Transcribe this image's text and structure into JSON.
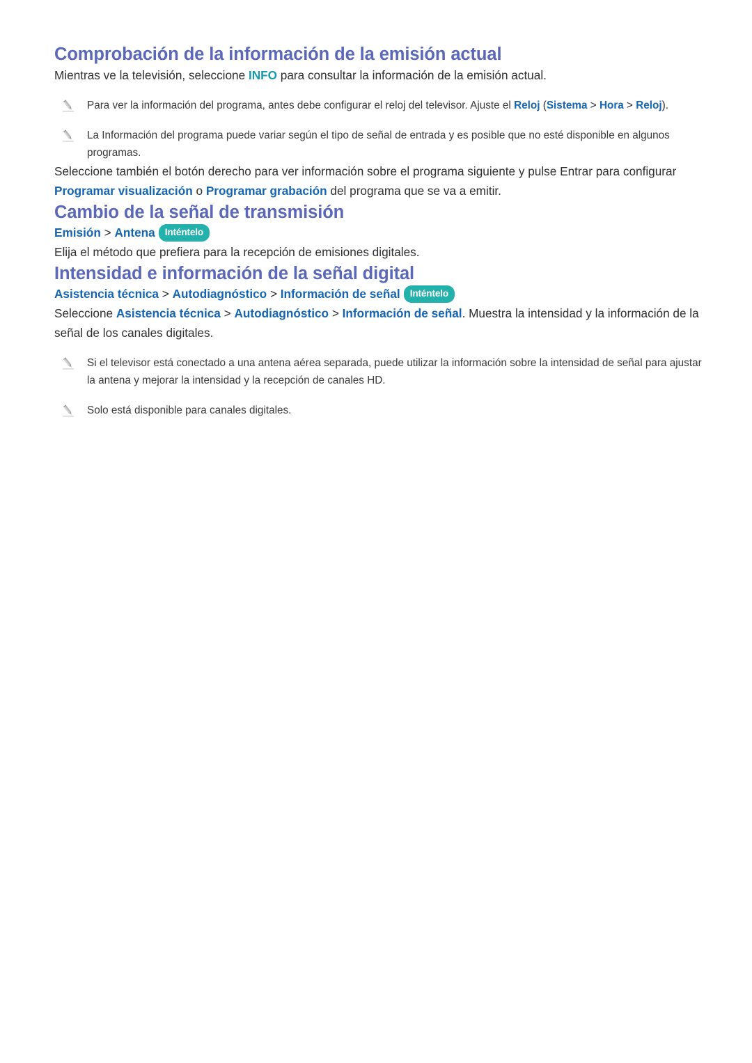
{
  "document": {
    "sections": [
      {
        "heading": "Comprobación de la información de la emisión actual",
        "intro_pre": "Mientras ve la televisión, seleccione ",
        "intro_key": "INFO",
        "intro_post": " para consultar la información de la emisión actual.",
        "notes": [
          {
            "pre": "Para ver la información del programa, antes debe configurar el reloj del televisor. Ajuste el ",
            "link1": "Reloj",
            "mid1": " (",
            "link2": "Sistema",
            "sep1": " > ",
            "link3": "Hora",
            "sep2": " > ",
            "link4": "Reloj",
            "post": ")."
          },
          {
            "text": "La Información del programa puede variar según el tipo de señal de entrada y es posible que no esté disponible en algunos programas."
          }
        ],
        "outro_pre": "Seleccione también el botón derecho para ver información sobre el programa siguiente y pulse Entrar para configurar ",
        "outro_link1": "Programar visualización",
        "outro_mid": " o ",
        "outro_link2": "Programar grabación",
        "outro_post": " del programa que se va a emitir."
      },
      {
        "heading": "Cambio de la señal de transmisión",
        "breadcrumb": {
          "items": [
            "Emisión",
            "Antena"
          ],
          "separator": " > ",
          "badge": "Inténtelo"
        },
        "body": "Elija el método que prefiera para la recepción de emisiones digitales."
      },
      {
        "heading": "Intensidad e información de la señal digital",
        "breadcrumb": {
          "items": [
            "Asistencia técnica",
            "Autodiagnóstico",
            "Información de señal"
          ],
          "separator": " > ",
          "badge": "Inténtelo"
        },
        "body_pre": "Seleccione ",
        "body_link1": "Asistencia técnica",
        "body_sep1": " > ",
        "body_link2": "Autodiagnóstico",
        "body_sep2": " > ",
        "body_link3": "Información de señal",
        "body_post": ". Muestra la intensidad y la información de la señal de los canales digitales.",
        "notes": [
          {
            "text": "Si el televisor está conectado a una antena aérea separada, puede utilizar la información sobre la intensidad de señal para ajustar la antena y mejorar la intensidad y la recepción de canales HD."
          },
          {
            "text": "Solo está disponible para canales digitales."
          }
        ]
      }
    ]
  },
  "colors": {
    "heading": "#5b68b8",
    "link": "#1565b0",
    "key_teal": "#1a9aa8",
    "badge_bg": "#22b2ab",
    "body": "#2f2f2f"
  },
  "icons": {
    "note_bullet": "pencil-icon"
  }
}
